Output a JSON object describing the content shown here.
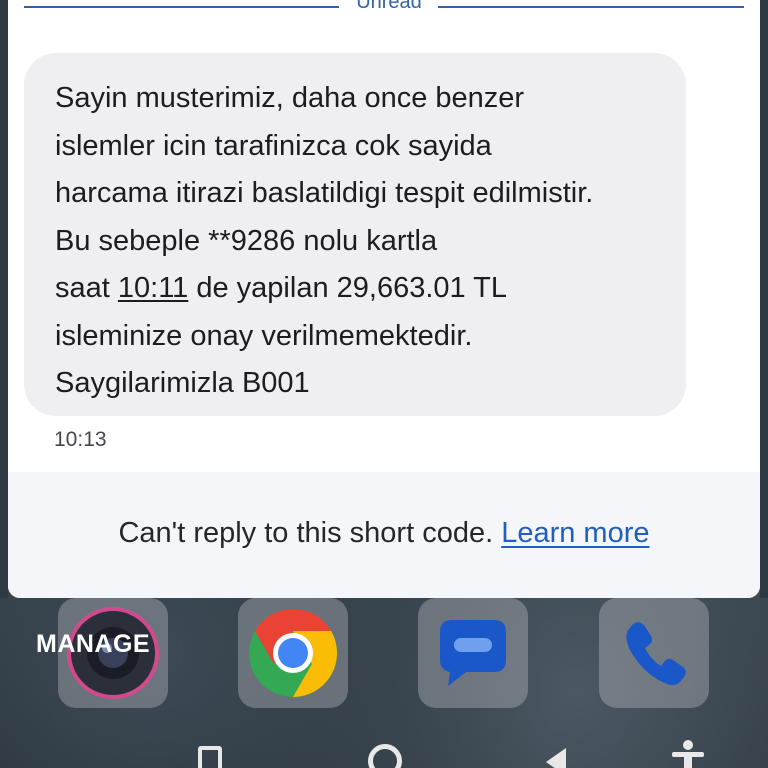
{
  "conversation": {
    "unread_divider": "Unread",
    "message": {
      "lines": [
        "Sayin musterimiz, daha once benzer",
        "islemler icin tarafinizca cok sayida",
        "harcama itirazi baslatildigi tespit edilmistir.",
        "Bu sebeple **9286 nolu  kartla",
        "de yapilan 29,663.01 TL",
        "isleminize onay verilmemektedir.",
        "Saygilarimizla B001"
      ],
      "line5_prefix": "saat ",
      "line5_time_link": "10:11",
      "timestamp": "10:13"
    },
    "footer": {
      "text": "Can't reply to this short code.",
      "link": "Learn more"
    }
  },
  "dock": {
    "manage_label": "MANAGE",
    "apps": [
      {
        "name": "camera-icon"
      },
      {
        "name": "chrome-icon"
      },
      {
        "name": "messages-icon"
      },
      {
        "name": "phone-icon"
      }
    ]
  },
  "colors": {
    "accent": "#2f62a8",
    "link": "#1f5fbf",
    "bubble": "#efeff1"
  }
}
